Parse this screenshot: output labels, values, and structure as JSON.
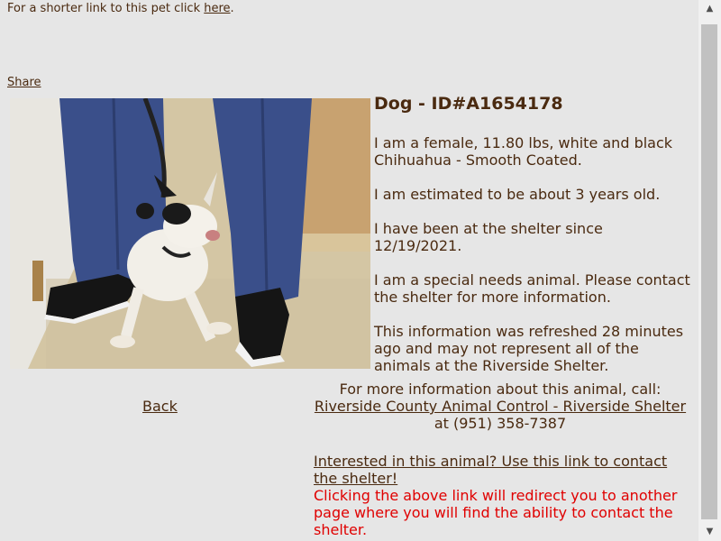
{
  "top": {
    "short_link_prefix": "For a shorter link to this pet click ",
    "short_link_text": "here",
    "short_link_suffix": "."
  },
  "share_label": "Share",
  "pet": {
    "title": "Dog - ID#A1654178",
    "description": "I am a female, 11.80 lbs, white and black Chihuahua - Smooth Coated.",
    "age": "I am estimated to be about 3 years old.",
    "since": "I have been at the shelter since 12/19/2021.",
    "special_needs": "I am a special needs animal. Please contact the shelter for more information.",
    "refreshed": "This information was refreshed 28 minutes ago and may not represent all of the animals at the Riverside Shelter."
  },
  "contact": {
    "intro": "For more information about this animal, call:",
    "shelter_link": "Riverside County Animal Control - Riverside Shelter",
    "phone_text": " at (951) 358-7387"
  },
  "back_label": "Back",
  "interested": {
    "link_text": "Interested in this animal? Use this link to contact the shelter!",
    "redirect_note": "Clicking the above link will redirect you to another page where you will find the ability to contact the shelter."
  },
  "colors": {
    "text": "#4a2a10",
    "warning": "#e00000",
    "background": "#e6e6e6"
  }
}
